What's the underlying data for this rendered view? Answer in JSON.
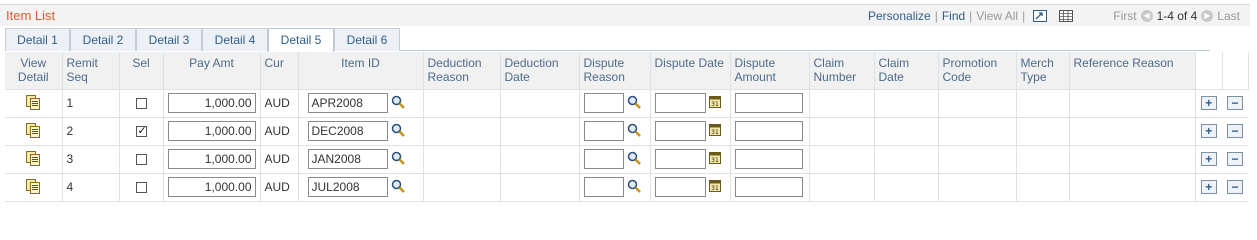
{
  "grid": {
    "title": "Item List",
    "nav": {
      "personalize": "Personalize",
      "find": "Find",
      "view_all": "View All",
      "first": "First",
      "range": "1-4 of 4",
      "last": "Last"
    }
  },
  "tabs": [
    {
      "label": "Detail 1",
      "active": false
    },
    {
      "label": "Detail 2",
      "active": false
    },
    {
      "label": "Detail 3",
      "active": false
    },
    {
      "label": "Detail 4",
      "active": false
    },
    {
      "label": "Detail 5",
      "active": true
    },
    {
      "label": "Detail 6",
      "active": false
    }
  ],
  "columns": {
    "view_detail": "View Detail",
    "remit_seq": "Remit Seq",
    "sel": "Sel",
    "pay_amt": "Pay Amt",
    "cur": "Cur",
    "item_id": "Item ID",
    "deduction_reason": "Deduction Reason",
    "deduction_date": "Deduction Date",
    "dispute_reason": "Dispute Reason",
    "dispute_date": "Dispute Date",
    "dispute_amount": "Dispute Amount",
    "claim_number": "Claim Number",
    "claim_date": "Claim Date",
    "promotion_code": "Promotion Code",
    "merch_type": "Merch Type",
    "reference_reason": "Reference Reason"
  },
  "rows": [
    {
      "seq": "1",
      "selected": false,
      "pay_amt": "1,000.00",
      "cur": "AUD",
      "item_id": "APR2008",
      "dispute_reason": "",
      "dispute_date": "",
      "dispute_amount": ""
    },
    {
      "seq": "2",
      "selected": true,
      "pay_amt": "1,000.00",
      "cur": "AUD",
      "item_id": "DEC2008",
      "dispute_reason": "",
      "dispute_date": "",
      "dispute_amount": ""
    },
    {
      "seq": "3",
      "selected": false,
      "pay_amt": "1,000.00",
      "cur": "AUD",
      "item_id": "JAN2008",
      "dispute_reason": "",
      "dispute_date": "",
      "dispute_amount": ""
    },
    {
      "seq": "4",
      "selected": false,
      "pay_amt": "1,000.00",
      "cur": "AUD",
      "item_id": "JUL2008",
      "dispute_reason": "",
      "dispute_date": "",
      "dispute_amount": ""
    }
  ],
  "icons": {
    "view_detail": "detail-page-icon",
    "lookup": "magnifier-icon",
    "calendar": "calendar-icon",
    "add_row": "plus-icon",
    "delete_row": "minus-icon"
  },
  "colors": {
    "title": "#d65d2b",
    "link": "#2f5e8c",
    "header_bg": "#f1f1f1",
    "border": "#dde2e7"
  }
}
